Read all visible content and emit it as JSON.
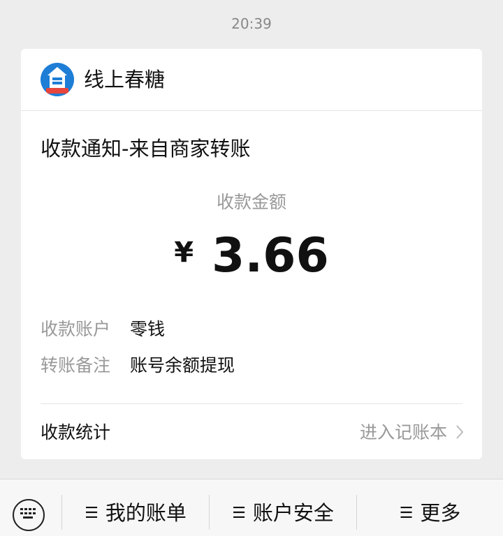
{
  "timestamp": "20:39",
  "merchant": {
    "name": "线上春糖",
    "logo_glyph": "食",
    "logo_color": "#1e7ed6",
    "logo_ribbon_color": "#e8453c"
  },
  "notice": {
    "title": "收款通知-来自商家转账",
    "amount_label": "收款金额",
    "currency": "¥",
    "amount": "3.66",
    "rows": [
      {
        "label": "收款账户",
        "value": "零钱"
      },
      {
        "label": "转账备注",
        "value": "账号余额提现"
      }
    ],
    "stats_label": "收款统计",
    "stats_link": "进入记账本"
  },
  "bottom_menu": {
    "keyboard_icon": "keyboard-icon",
    "items": [
      {
        "label": "我的账单",
        "icon": "menu-icon"
      },
      {
        "label": "账户安全",
        "icon": "menu-icon"
      },
      {
        "label": "更多",
        "icon": "menu-icon"
      }
    ]
  }
}
